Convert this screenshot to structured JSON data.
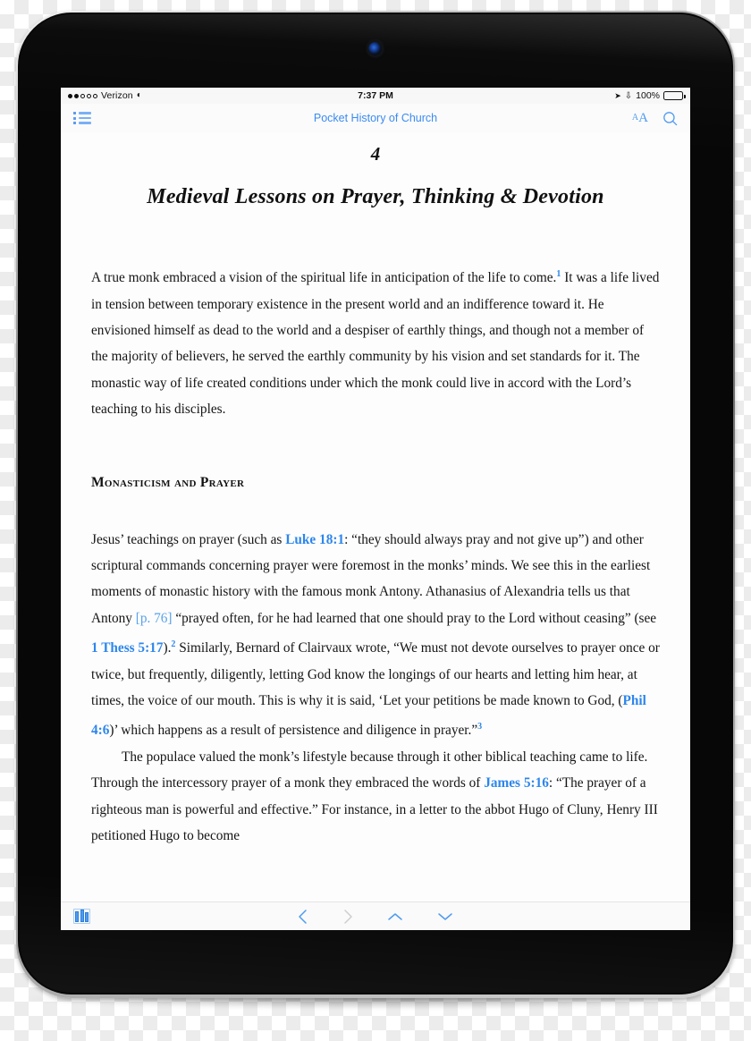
{
  "device": {
    "type": "tablet",
    "camera_icon": "front-camera"
  },
  "status_bar": {
    "signal_dots_filled": 2,
    "signal_dots_total": 5,
    "carrier": "Verizon",
    "wifi_icon": "wifi-icon",
    "time": "7:37 PM",
    "location_icon": "location-arrow-icon",
    "bluetooth_icon": "bluetooth-icon",
    "battery_percent": "100%",
    "battery_level": 100
  },
  "nav_bar": {
    "toc_icon": "table-of-contents-icon",
    "title": "Pocket History of Church",
    "font_size_label_small": "A",
    "font_size_label_big": "A",
    "search_icon": "search-icon",
    "accent_color": "#3a8bf2"
  },
  "page": {
    "chapter_number": "4",
    "chapter_title": "Medieval Lessons on Prayer, Thinking & Devotion",
    "paragraph_intro": {
      "part1": "A true monk embraced a vision of the spiritual life in anticipation of the life to come.",
      "footnote1": "1",
      "part2": " It was a life lived in tension between temporary existence in the present world and an indifference toward it. He envisioned himself as dead to the world and a despiser of earthly things, and though not a member of the majority of believers, he served the earthly community by his vision and set standards for it. The monastic way of life created conditions under which the monk could live in accord with the Lord’s teaching to his disciples."
    },
    "section_heading": "Monasticism and Prayer",
    "paragraph_prayer": {
      "part1": "Jesus’ teachings on prayer (such as ",
      "link_luke": "Luke 18:1",
      "part2": ": “they should always pray and not give up”) and other scriptural commands concerning prayer were foremost in the monks’ minds. We see this in the earliest moments of monastic history with the famous monk Antony. Athanasius of Alexandria tells us that Antony ",
      "page_marker": "[p. 76]",
      "part3": " “prayed often, for he had learned that one should pray to the Lord without ceasing” (see ",
      "link_thess": "1 Thess 5:17",
      "part4": ").",
      "footnote2": "2",
      "part5": " Similarly, Bernard of Clairvaux wrote, “We must not devote ourselves to prayer once or twice, but frequently, diligently, letting God know the longings of our hearts and letting him hear, at times, the voice of our mouth. This is why it is said, ‘Let your petitions be made known to God, (",
      "link_phil": "Phil 4:6",
      "part6": ")’ which happens as a result of persistence and diligence in prayer.”",
      "footnote3": "3"
    },
    "paragraph_populace": {
      "part1": "The populace valued the monk’s lifestyle because through it other biblical teaching came to life. Through the intercessory prayer of a monk they embraced the words of ",
      "link_james": "James 5:16",
      "part2": ": “The prayer of a righteous man is powerful and effective.” For instance, in a letter to the abbot Hugo of Cluny, Henry III petitioned Hugo to become"
    },
    "link_color": "#2d86ec",
    "page_marker_color": "#5aa2e8"
  },
  "bottom_bar": {
    "library_icon": "library-books-icon",
    "back_icon": "chevron-left-icon",
    "forward_icon": "chevron-right-icon",
    "up_icon": "chevron-up-icon",
    "down_icon": "chevron-down-icon",
    "back_enabled": true,
    "forward_enabled": false
  }
}
